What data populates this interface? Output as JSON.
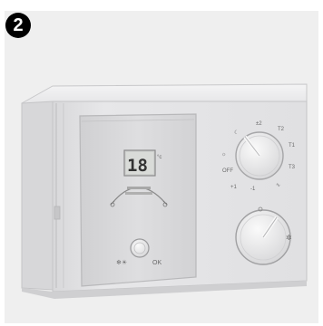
{
  "step_badge": "2",
  "display": {
    "value": "18",
    "unit": "°c"
  },
  "left_panel": {
    "button_icon": "snowflake-sun-icon",
    "button_label": "OK"
  },
  "mode_dial": {
    "labels": [
      "☾",
      "☼",
      "±2",
      "T2",
      "T1",
      "OFF",
      "T3",
      "+1",
      "-1",
      "∿"
    ]
  },
  "bottom_dial": {
    "icon": "knob-icon"
  },
  "colors": {
    "device_body": "#e4e4e6",
    "panel": "#dcdcde",
    "background": "#efefef"
  }
}
